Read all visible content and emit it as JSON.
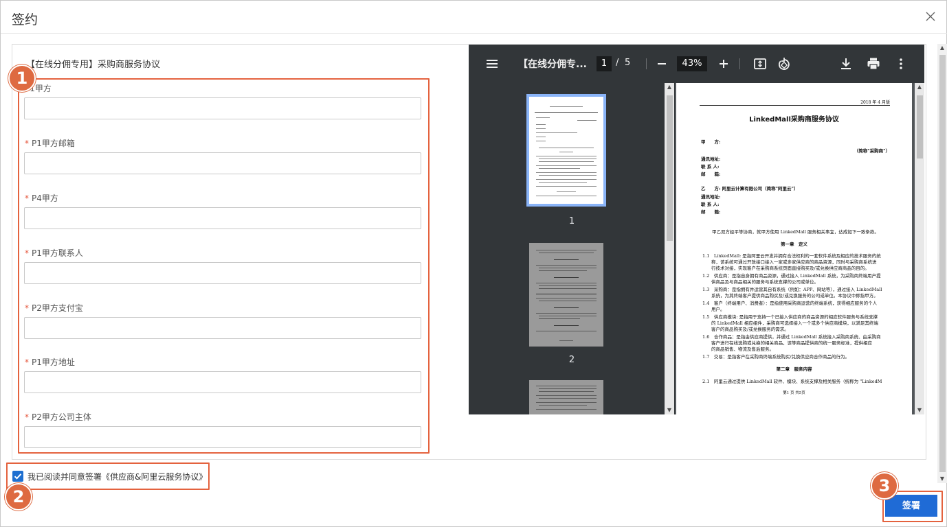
{
  "dialog": {
    "title": "签约"
  },
  "form": {
    "title": "【在线分佣专用】采购商服务协议",
    "fields": [
      {
        "label": "P1甲方",
        "required": false,
        "value": ""
      },
      {
        "label": "P1甲方邮箱",
        "required": true,
        "value": ""
      },
      {
        "label": "P4甲方",
        "required": true,
        "value": ""
      },
      {
        "label": "P1甲方联系人",
        "required": true,
        "value": ""
      },
      {
        "label": "P2甲方支付宝",
        "required": true,
        "value": ""
      },
      {
        "label": "P1甲方地址",
        "required": true,
        "value": ""
      },
      {
        "label": "P2甲方公司主体",
        "required": true,
        "value": ""
      }
    ],
    "required_mark": "*"
  },
  "viewer": {
    "doc_name": "【在线分佣专...",
    "current_page": "1",
    "page_sep": "/",
    "total_pages": "5",
    "zoom": "43%",
    "thumbnails": [
      {
        "label": "1",
        "selected": true
      },
      {
        "label": "2",
        "selected": false
      }
    ],
    "page": {
      "date": "2018 年 4 月版",
      "title": "LinkedMall采购商服务协议",
      "party_a": "甲　　方:",
      "party_a_alias": "（简称\"采购商\"）",
      "addr": "通讯地址:",
      "contact": "联 系 人:",
      "email": "邮　　箱:",
      "party_b": "乙　　方: 阿里云计算有限公司（简称\"阿里云\"）",
      "intro": "甲乙双方经平等协商，就甲方使用 LinkedMall 服务相关事宜，达成如下一致条款。",
      "chapter1": "第一章　定义",
      "clauses": [
        "1.1　LinkedMall: 是指阿里云开发并拥有合法权利的一套软件系统及相应的技术服务的统",
        "　　称，该系统可通过开放接口接入一家或多家供应商的商品资源，同时与采购商系统进",
        "　　行技术对接，实现客户在采购商系统页面直接购买及/或兑换供应商商品的目的。",
        "1.2　供应商：是指自身拥有商品资源，通过接入 LinkedMall 系统，为采购商终端用户提",
        "　　供商品及与商品相关的服务与系统支撑的公司或单位。",
        "1.3　采购商：是指拥有并运营其自有系统（例如：APP、网站等），通过接入 LinkedMall",
        "　　系统，为其终端客户提供商品购买及/或兑换服务的公司或单位。本协议中即指甲方。",
        "1.4　客户（终端用户、消费者）：是指使用采购商运营的终端系统，获得相应服务的个人",
        "　　用户。",
        "1.5　供应商模块: 是指用于支持一个已接入供应商的商品资源的相应软件服务与系统支撑",
        "　　的 LinkedMall 相应组件，采购商可选择接入一个或多个供应商模块，以满足其终端",
        "　　客户的商品购买及/或兑换服务的需求。",
        "1.6　合作商品：是指由供应商提供，并通过 LinkedMall 系统接入采购商系统、由采购商",
        "　　客户进行在线选购或兑换的相关商品，该等商品提供商的统一服务标准，提供相应",
        "　　的商品销售、物流及售后服务。",
        "1.7　交易：是指客户在采购商终端系统购买/兑换供应商合作商品的行为。"
      ],
      "chapter2": "第二章　服务内容",
      "clause21": "2.1　阿里云通过提供 LinkedMall 软件、模块、系统支撑及相关服务（统称为 \"LinkedM",
      "footer": "第1 页 共5页"
    }
  },
  "agreement": {
    "checked": true,
    "label": "我已阅读并同意签署《供应商&阿里云服务协议》"
  },
  "actions": {
    "sign_label": "签署"
  },
  "annotations": [
    "1",
    "2",
    "3"
  ],
  "colors": {
    "accent": "#1f6bd6",
    "annotation": "#e4623e",
    "viewer_toolbar": "#323639"
  }
}
